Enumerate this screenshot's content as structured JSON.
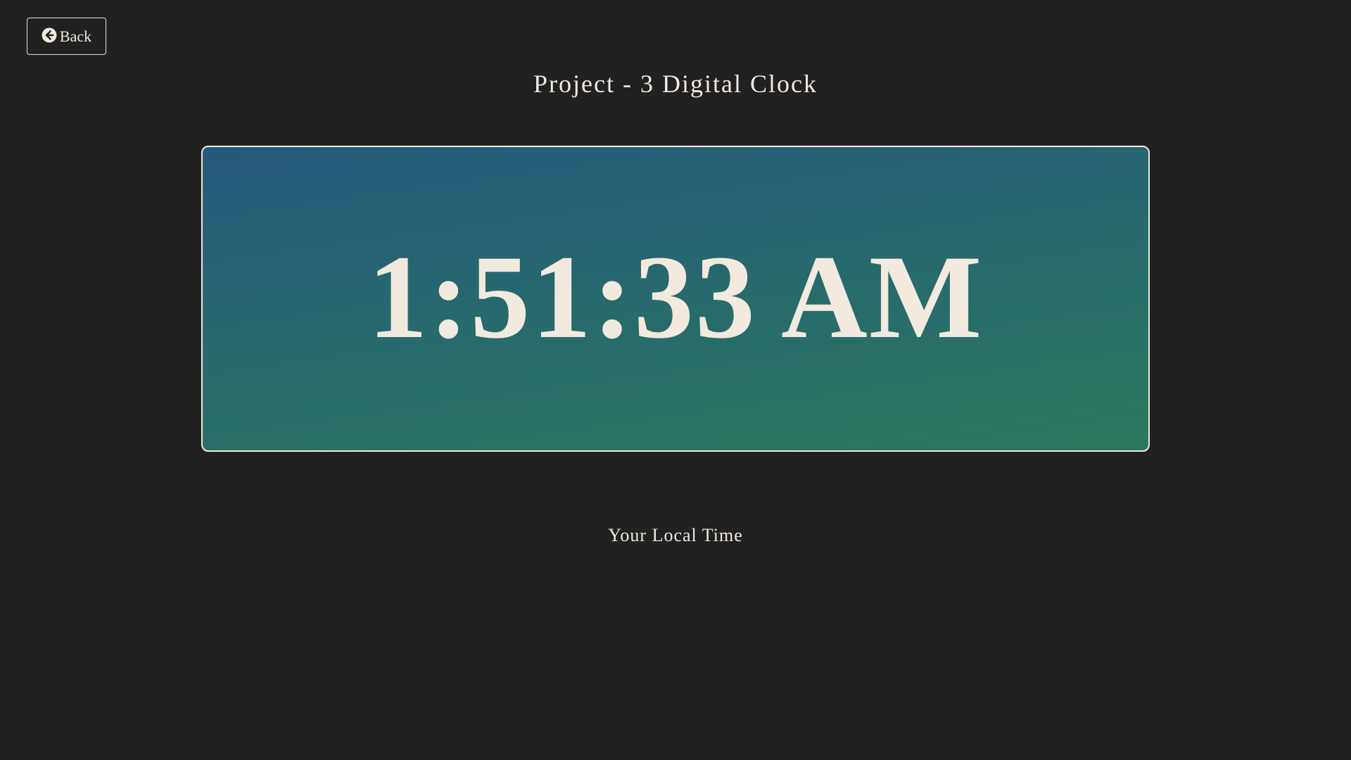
{
  "nav": {
    "back_label": "Back",
    "back_icon": "arrow-circle-left-icon"
  },
  "page": {
    "title": "Project - 3 Digital Clock"
  },
  "clock": {
    "time": "1:51:33 AM",
    "caption": "Your Local Time",
    "gradient_top": "#245a7c",
    "gradient_bottom": "#2c785e",
    "text_color": "#f2e9df"
  },
  "colors": {
    "background": "#212121",
    "text": "#f2e9df"
  }
}
